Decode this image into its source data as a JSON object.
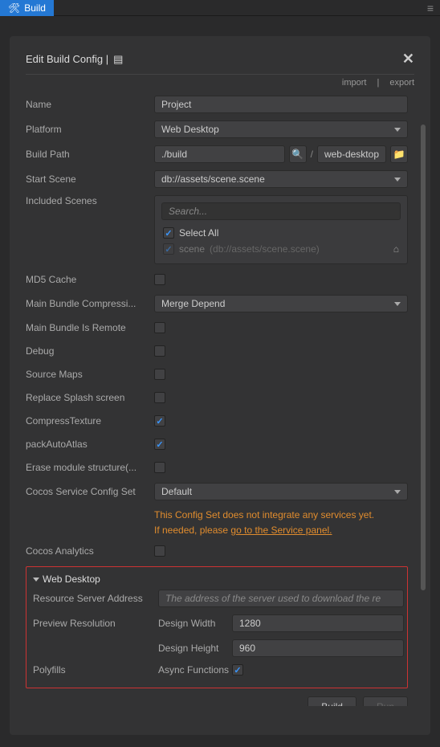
{
  "topbar": {
    "tab_label": "Build"
  },
  "panel": {
    "title": "Edit Build Config |",
    "import": "import",
    "export": "export"
  },
  "form": {
    "name_label": "Name",
    "name_value": "Project",
    "platform_label": "Platform",
    "platform_value": "Web Desktop",
    "buildpath_label": "Build Path",
    "buildpath_value": "./build",
    "buildpath_suffix": "web-desktop",
    "startscene_label": "Start Scene",
    "startscene_value": "db://assets/scene.scene",
    "includedscenes_label": "Included Scenes",
    "search_placeholder": "Search...",
    "select_all": "Select All",
    "scene_item_name": "scene",
    "scene_item_path": "(db://assets/scene.scene)",
    "md5_label": "MD5 Cache",
    "mbc_label": "Main Bundle Compressi...",
    "mbc_value": "Merge Depend",
    "mbremote_label": "Main Bundle Is Remote",
    "debug_label": "Debug",
    "sourcemaps_label": "Source Maps",
    "splash_label": "Replace Splash screen",
    "compresstex_label": "CompressTexture",
    "packauto_label": "packAutoAtlas",
    "erase_label": "Erase module structure(...",
    "svcconfig_label": "Cocos Service Config Set",
    "svcconfig_value": "Default",
    "warning_line1": "This Config Set does not integrate any services yet.",
    "warning_line2a": "If needed, please ",
    "warning_link": "go to the Service panel.",
    "analytics_label": "Cocos Analytics",
    "section_title": "Web Desktop",
    "resaddr_label": "Resource Server Address",
    "resaddr_placeholder": "The address of the server used to download the re",
    "preview_label": "Preview Resolution",
    "design_width_label": "Design Width",
    "design_width_value": "1280",
    "design_height_label": "Design Height",
    "design_height_value": "960",
    "polyfills_label": "Polyfills",
    "async_label": "Async Functions"
  },
  "footer": {
    "build": "Build",
    "run": "Run"
  }
}
